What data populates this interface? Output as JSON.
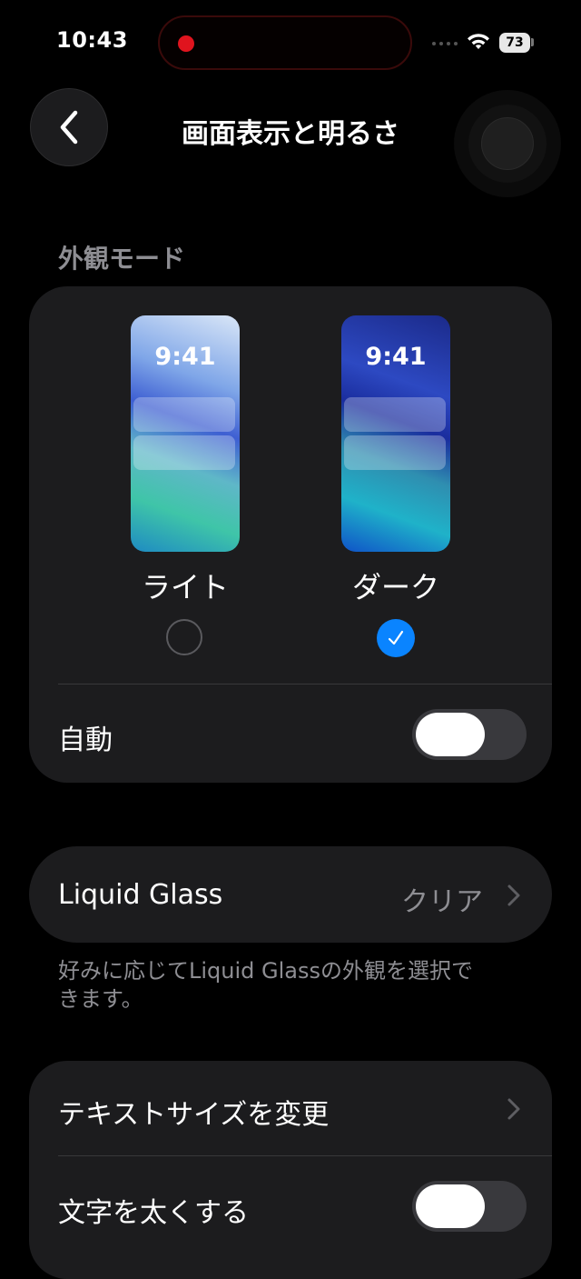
{
  "status_bar": {
    "time": "10:43",
    "battery": "73"
  },
  "nav": {
    "title": "画面表示と明るさ"
  },
  "appearance": {
    "header": "外観モード",
    "options": [
      {
        "label": "ライト",
        "preview_time": "9:41",
        "selected": false
      },
      {
        "label": "ダーク",
        "preview_time": "9:41",
        "selected": true
      }
    ],
    "auto_label": "自動",
    "auto_on": false
  },
  "liquid_glass": {
    "label": "Liquid Glass",
    "value": "クリア",
    "footer": "好みに応じてLiquid Glassの外観を選択できます。"
  },
  "text": {
    "text_size_label": "テキストサイズを変更",
    "bold_label": "文字を太くする",
    "bold_on": false
  },
  "colors": {
    "accent": "#0a84ff",
    "card": "#1c1c1e",
    "secondary_text": "#8e8e93",
    "recording": "#e0141e"
  }
}
